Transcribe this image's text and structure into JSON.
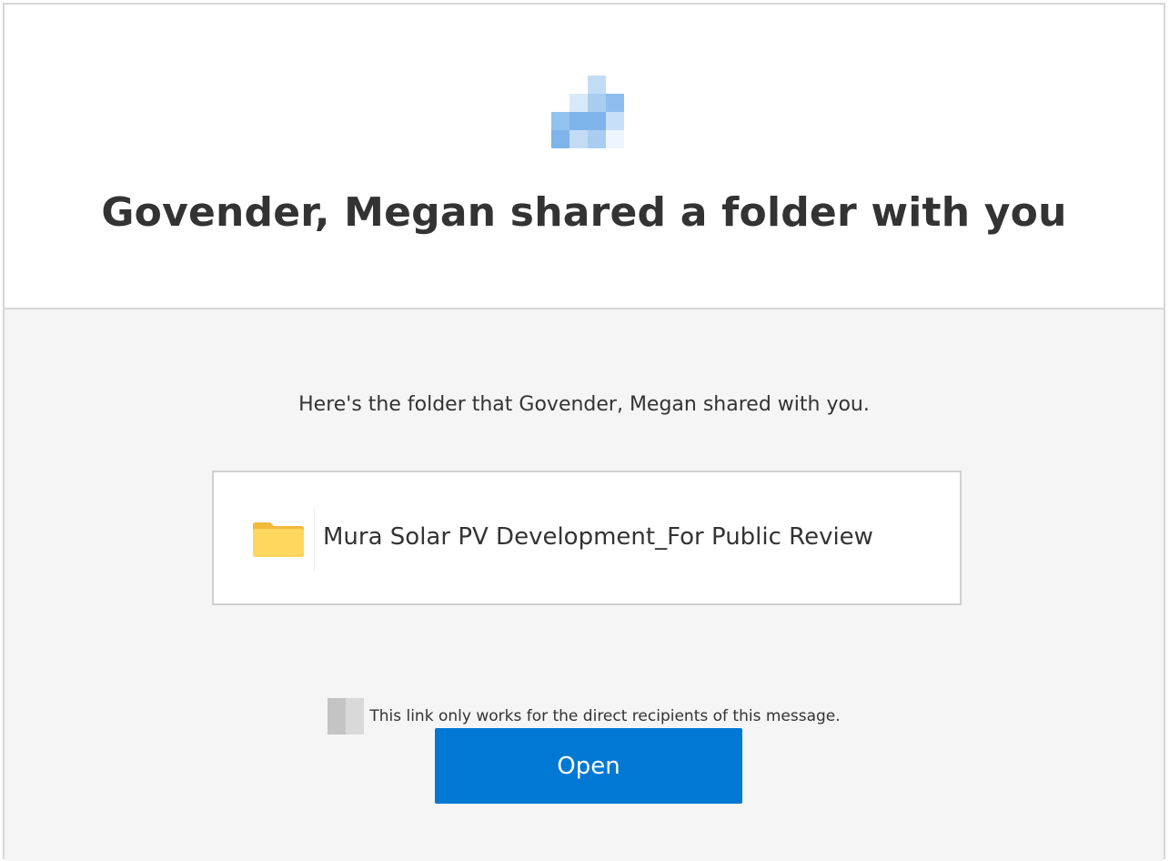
{
  "header": {
    "logo_icon": "brand-logo-icon",
    "title": "Govender, Megan shared a folder with you"
  },
  "main": {
    "intro": "Here's the folder that Govender, Megan shared with you.",
    "folder": {
      "icon": "folder-icon",
      "name": "Mura Solar PV Development_For Public Review"
    },
    "notice": {
      "icon": "lock-icon",
      "text": "This link only works for the direct recipients of this message."
    },
    "open_button": {
      "label": "Open"
    }
  },
  "colors": {
    "accent": "#0078d4",
    "folder_yellow": "#ffd75e",
    "body_bg": "#f5f5f5"
  }
}
